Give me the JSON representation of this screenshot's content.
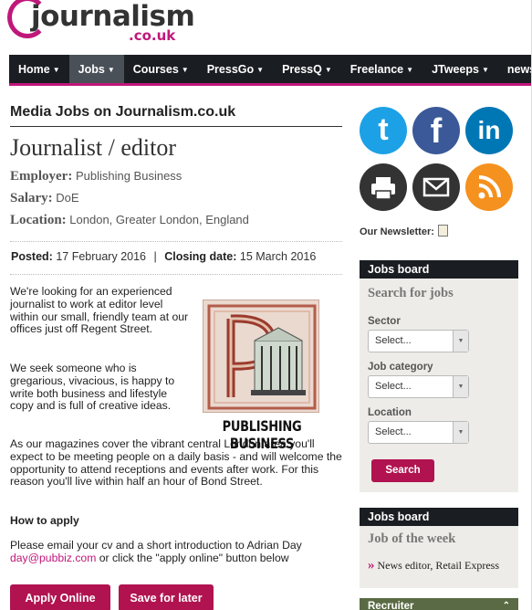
{
  "logo": {
    "name": "journalism",
    "domain": ".co.uk"
  },
  "nav": {
    "items": [
      {
        "label": "Home"
      },
      {
        "label": "Jobs"
      },
      {
        "label": "Courses"
      },
      {
        "label": "PressGo"
      },
      {
        "label": "PressQ"
      },
      {
        "label": "Freelance"
      },
      {
        "label": "JTweeps"
      },
      {
        "label": "news:rw ti"
      }
    ],
    "active": "Jobs"
  },
  "main": {
    "section_title": "Media Jobs on Journalism.co.uk",
    "job_title": "Journalist / editor",
    "employer_label": "Employer:",
    "employer": "Publishing Business",
    "salary_label": "Salary:",
    "salary": "DoE",
    "location_label": "Location:",
    "location": "London, Greater London, England",
    "posted_label": "Posted:",
    "posted": "17 February 2016",
    "closing_label": "Closing date:",
    "closing": "15 March 2016",
    "para1": "We're looking for an experienced journalist to work at editor level within our small, friendly team at our offices just off Regent Street.",
    "para2": "We seek someone who is gregarious, vivacious, is happy to write both business and lifestyle copy and is full of creative ideas.",
    "para3": "As our magazines cover the vibrant central London area you'll expect to be meeting people on a daily basis - and will welcome the opportunity to attend receptions and events after work. For this reason you'll live within half an hour of Bond Street.",
    "how_to_apply": "How to apply",
    "para4_pre": "Please email your cv and a short introduction to Adrian Day",
    "email": "day@pubbiz.com",
    "para4_post": " or click the \"apply online\" button below",
    "image_caption": "PUBLISHING BUSINESS",
    "apply_button": "Apply Online",
    "save_button": "Save for later"
  },
  "sidebar": {
    "social": [
      {
        "icon": "twitter-icon",
        "glyph": "t",
        "color": "#1da1e6"
      },
      {
        "icon": "facebook-icon",
        "glyph": "f",
        "color": "#3b5998"
      },
      {
        "icon": "linkedin-icon",
        "glyph": "in",
        "color": "#0077b5"
      },
      {
        "icon": "print-icon",
        "color": "#333333"
      },
      {
        "icon": "mail-icon",
        "color": "#333333"
      },
      {
        "icon": "rss-icon",
        "color": "#f5911e"
      }
    ],
    "newsletter_label": "Our Newsletter:",
    "jobs_board_title": "Jobs board",
    "search_title": "Search for jobs",
    "sector_label": "Sector",
    "category_label": "Job category",
    "location_label": "Location",
    "select_placeholder": "Select...",
    "search_button": "Search",
    "jobs_board_title_2": "Jobs board",
    "job_of_week_title": "Job of the week",
    "job_of_week_item": "News editor, Retail Express",
    "recruiter_label": "Recruiter",
    "accent_color": "#b0134f"
  }
}
